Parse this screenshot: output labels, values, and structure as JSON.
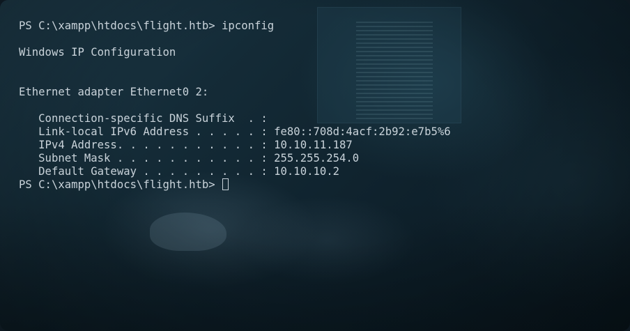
{
  "terminal": {
    "lines": [
      "PS C:\\xampp\\htdocs\\flight.htb> ipconfig",
      "",
      "Windows IP Configuration",
      "",
      "",
      "Ethernet adapter Ethernet0 2:",
      "",
      "   Connection-specific DNS Suffix  . :",
      "   Link-local IPv6 Address . . . . . : fe80::708d:4acf:2b92:e7b5%6",
      "   IPv4 Address. . . . . . . . . . . : 10.10.11.187",
      "   Subnet Mask . . . . . . . . . . . : 255.255.254.0",
      "   Default Gateway . . . . . . . . . : 10.10.10.2"
    ],
    "prompt": "PS C:\\xampp\\htdocs\\flight.htb> "
  },
  "colors": {
    "text": "#c9d3da",
    "background": "#0f222d"
  }
}
